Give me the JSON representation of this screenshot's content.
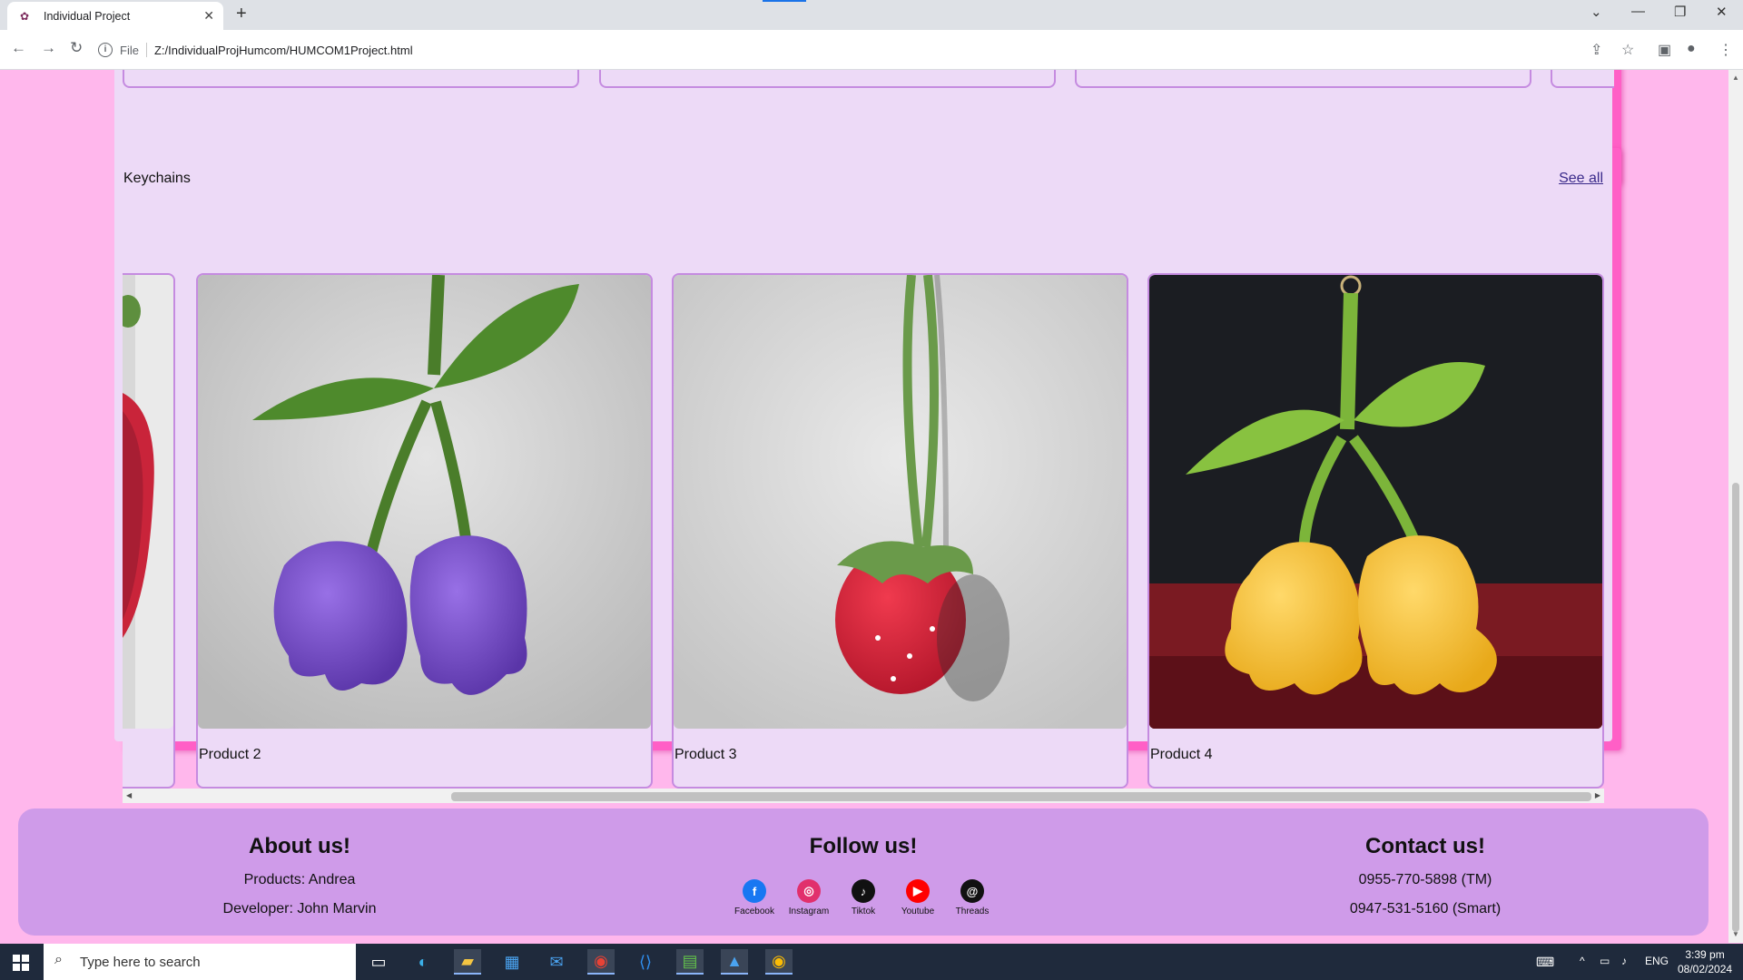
{
  "browser": {
    "tab_title": "Individual Project",
    "address_prefix": "File",
    "url": "Z:/IndividualProjHumcom/HUMCOM1Project.html"
  },
  "keychains": {
    "title": "Keychains",
    "see_all": "See all",
    "products": [
      {
        "caption": "Product 2",
        "image": "purple bellflower crochet keychain"
      },
      {
        "caption": "Product 3",
        "image": "red strawberry crochet keychain"
      },
      {
        "caption": "Product 4",
        "image": "yellow bellflower crochet keychain"
      }
    ]
  },
  "footer": {
    "about": {
      "title": "About us!",
      "line1": "Products: Andrea",
      "line2": "Developer: John Marvin"
    },
    "follow": {
      "title": "Follow us!",
      "links": [
        {
          "label": "Facebook",
          "icon": "facebook-icon",
          "color": "#1877f2",
          "glyph": "f"
        },
        {
          "label": "Instagram",
          "icon": "instagram-icon",
          "color": "#e1306c",
          "glyph": "◎"
        },
        {
          "label": "Tiktok",
          "icon": "tiktok-icon",
          "color": "#111111",
          "glyph": "♪"
        },
        {
          "label": "Youtube",
          "icon": "youtube-icon",
          "color": "#ff0000",
          "glyph": "▶"
        },
        {
          "label": "Threads",
          "icon": "threads-icon",
          "color": "#111111",
          "glyph": "@"
        }
      ]
    },
    "contact": {
      "title": "Contact us!",
      "line1": "0955-770-5898 (TM)",
      "line2": "0947-531-5160 (Smart)"
    }
  },
  "taskbar": {
    "search_placeholder": "Type here to search",
    "language": "ENG",
    "time": "3:39 pm",
    "date": "08/02/2024"
  },
  "colors": {
    "page_bg": "#ffb7ec",
    "section_bg": "#eddaf7",
    "section_shadow": "#ff5fc6",
    "footer_bg": "#cf9be9",
    "card_border": "#c58be0"
  }
}
